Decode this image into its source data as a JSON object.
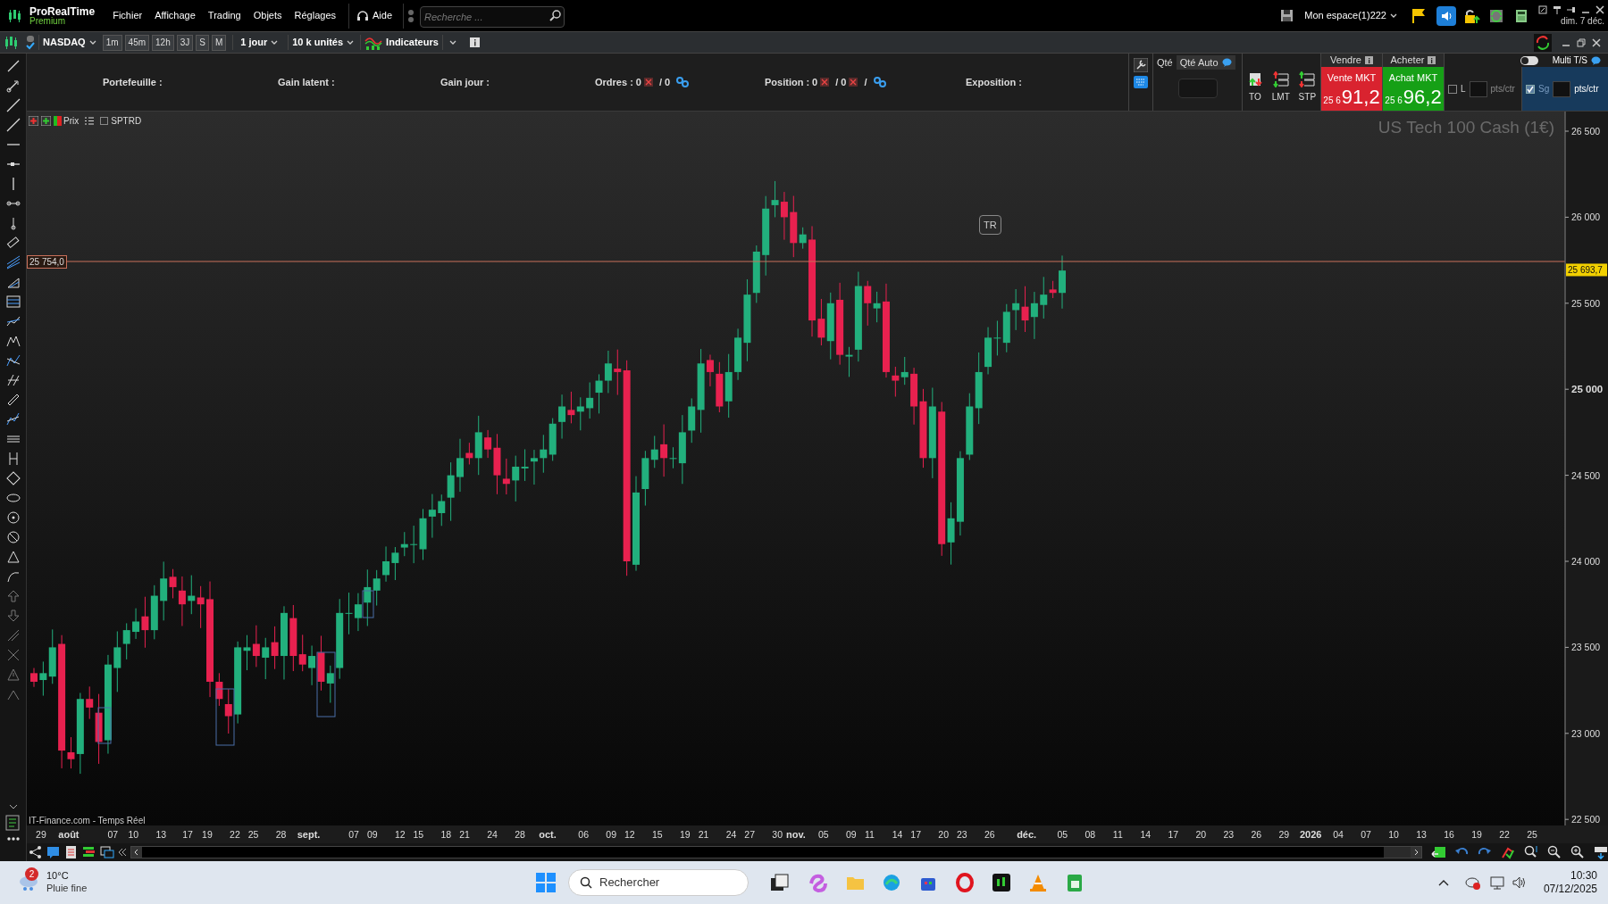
{
  "app": {
    "name": "ProRealTime",
    "edition": "Premium"
  },
  "menu": [
    "Fichier",
    "Affichage",
    "Trading",
    "Objets",
    "Réglages"
  ],
  "help": "Aide",
  "search": {
    "placeholder": "Recherche ..."
  },
  "workspace": "Mon espace(1)222",
  "date_short": "dim. 7 déc.",
  "toolbar": {
    "instrument": "NASDAQ",
    "periods": [
      "1m",
      "45m",
      "12h",
      "3J",
      "S",
      "M"
    ],
    "timeframe": "1 jour",
    "units": "10 k unités",
    "indicators": "Indicateurs"
  },
  "summary": [
    "Portefeuille :",
    "Gain latent :",
    "Gain jour :"
  ],
  "orders": {
    "label": "Ordres :",
    "count": "0",
    "count_2": "/ 0"
  },
  "position": {
    "label": "Position :",
    "count": "0",
    "count_2": "/ 0",
    "sep": "/"
  },
  "exposition": "Exposition :",
  "order_panel": {
    "qty_label": "Qté",
    "qty_auto": "Qté Auto",
    "order_types": [
      "TO",
      "LMT",
      "STP"
    ],
    "sell": {
      "header": "Vendre",
      "button": "Vente MKT",
      "price_prefix": "25 6",
      "price_main": "91,2"
    },
    "buy": {
      "header": "Acheter",
      "button": "Achat MKT",
      "price_prefix": "25 6",
      "price_main": "96,2"
    },
    "stops": [
      {
        "label": "L",
        "checked": false,
        "unit": "pts/ctr"
      },
      {
        "label": "Sg",
        "checked": true,
        "unit": "pts/ctr"
      }
    ],
    "multi_ts": {
      "label": "Multi T/S",
      "on": false
    }
  },
  "chart": {
    "legend": [
      {
        "label": "Prix"
      },
      {
        "label": "SPTRD",
        "checked": false
      }
    ],
    "instrument_title": "US Tech 100 Cash (1€)",
    "source": "IT-Finance.com - Temps Réel",
    "line_label": "25 754,0",
    "last_price": "25 693,7",
    "marker": "TR",
    "y_ticks": [
      {
        "label": "26 500",
        "bold": false
      },
      {
        "label": "26 000",
        "bold": false
      },
      {
        "label": "25 500",
        "bold": false
      },
      {
        "label": "25 000",
        "bold": true
      },
      {
        "label": "24 500",
        "bold": false
      },
      {
        "label": "24 000",
        "bold": false
      },
      {
        "label": "23 500",
        "bold": false
      },
      {
        "label": "23 000",
        "bold": false
      },
      {
        "label": "22 500",
        "bold": false
      }
    ],
    "x_labels": [
      {
        "label": "29",
        "kind": "day"
      },
      {
        "label": "août",
        "kind": "month"
      },
      {
        "label": "07",
        "kind": "day"
      },
      {
        "label": "10",
        "kind": "day"
      },
      {
        "label": "13",
        "kind": "day"
      },
      {
        "label": "17",
        "kind": "day"
      },
      {
        "label": "19",
        "kind": "day"
      },
      {
        "label": "22",
        "kind": "day"
      },
      {
        "label": "25",
        "kind": "day"
      },
      {
        "label": "28",
        "kind": "day"
      },
      {
        "label": "sept.",
        "kind": "month"
      },
      {
        "label": "07",
        "kind": "day"
      },
      {
        "label": "09",
        "kind": "day"
      },
      {
        "label": "12",
        "kind": "day"
      },
      {
        "label": "15",
        "kind": "day"
      },
      {
        "label": "18",
        "kind": "day"
      },
      {
        "label": "21",
        "kind": "day"
      },
      {
        "label": "24",
        "kind": "day"
      },
      {
        "label": "28",
        "kind": "day"
      },
      {
        "label": "oct.",
        "kind": "month"
      },
      {
        "label": "06",
        "kind": "day"
      },
      {
        "label": "09",
        "kind": "day"
      },
      {
        "label": "12",
        "kind": "day"
      },
      {
        "label": "15",
        "kind": "day"
      },
      {
        "label": "19",
        "kind": "day"
      },
      {
        "label": "21",
        "kind": "day"
      },
      {
        "label": "24",
        "kind": "day"
      },
      {
        "label": "27",
        "kind": "day"
      },
      {
        "label": "30",
        "kind": "day"
      },
      {
        "label": "nov.",
        "kind": "month"
      },
      {
        "label": "05",
        "kind": "day"
      },
      {
        "label": "09",
        "kind": "day"
      },
      {
        "label": "11",
        "kind": "day"
      },
      {
        "label": "14",
        "kind": "day"
      },
      {
        "label": "17",
        "kind": "day"
      },
      {
        "label": "20",
        "kind": "day"
      },
      {
        "label": "23",
        "kind": "day"
      },
      {
        "label": "26",
        "kind": "day"
      },
      {
        "label": "déc.",
        "kind": "month"
      },
      {
        "label": "05",
        "kind": "day"
      },
      {
        "label": "08",
        "kind": "day"
      },
      {
        "label": "11",
        "kind": "day"
      },
      {
        "label": "14",
        "kind": "day"
      },
      {
        "label": "17",
        "kind": "day"
      },
      {
        "label": "20",
        "kind": "day"
      },
      {
        "label": "23",
        "kind": "day"
      },
      {
        "label": "26",
        "kind": "day"
      },
      {
        "label": "29",
        "kind": "day"
      },
      {
        "label": "2026",
        "kind": "month"
      },
      {
        "label": "04",
        "kind": "day"
      },
      {
        "label": "07",
        "kind": "day"
      },
      {
        "label": "10",
        "kind": "day"
      },
      {
        "label": "13",
        "kind": "day"
      },
      {
        "label": "16",
        "kind": "day"
      },
      {
        "label": "19",
        "kind": "day"
      },
      {
        "label": "22",
        "kind": "day"
      },
      {
        "label": "25",
        "kind": "day"
      }
    ]
  },
  "taskbar": {
    "weather": {
      "badge": "2",
      "temp": "10°C",
      "desc": "Pluie fine"
    },
    "search": "Rechercher",
    "time": "10:30",
    "date": "07/12/2025"
  }
}
